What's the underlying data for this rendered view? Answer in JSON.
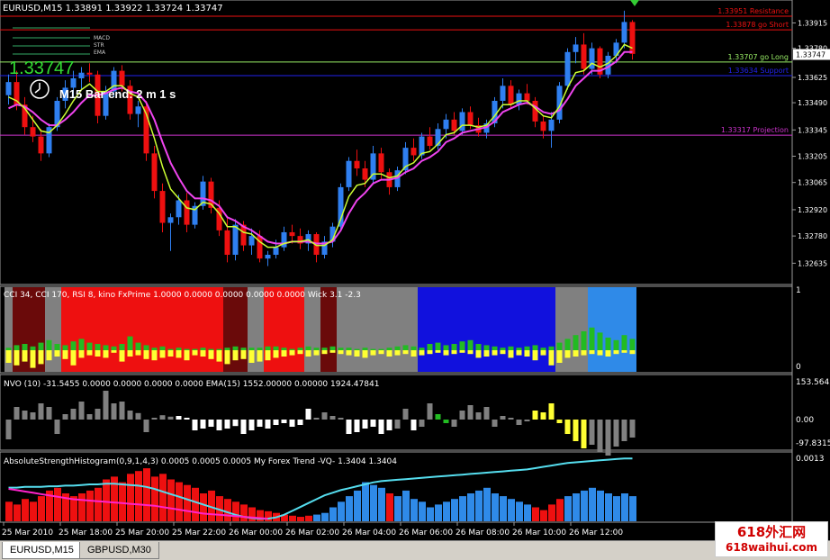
{
  "colors": {
    "bull": "#2f7ff0",
    "bear": "#ee1010",
    "fast_ma": "#ccff33",
    "slow_ma": "#ee44ee",
    "resistance": "#ee1111",
    "support": "#2222ee",
    "projection": "#cc33cc",
    "golong": "#99ee66",
    "grey": "#808080",
    "darkred": "#6a0a0a",
    "red": "#ee1010",
    "blue": "#1111dd",
    "lightblue": "#2f8ae8",
    "green": "#22bb22",
    "yellow": "#ffff33",
    "white": "#ffffff",
    "cyan": "#55ddee",
    "magenta": "#ff22cc"
  },
  "main": {
    "title": "EURUSD,M15  1.33891 1.33922 1.33724 1.33747",
    "price_big": "1.33747",
    "bar_end": "M15 Bar end: 2 m 1 s",
    "legend": [
      "MACD",
      "STR",
      "EMA"
    ],
    "levels": [
      {
        "label": "1.33951 Resistance",
        "value": 1.33951,
        "color": "resistance"
      },
      {
        "label": "1.33878 go Short",
        "value": 1.33878,
        "color": "resistance"
      },
      {
        "label": "1.33707 go Long",
        "value": 1.33707,
        "color": "golong"
      },
      {
        "label": "1.33634 Support",
        "value": 1.33634,
        "color": "support"
      },
      {
        "label": "1.33317 Projection",
        "value": 1.33317,
        "color": "projection"
      }
    ],
    "current_price_label": "1.33747",
    "current_price": 1.33747
  },
  "ind1": {
    "title": "CCI 34, CCI 170, RSI 8,  kino FxPrime  1.0000 0.0000 0.0000 0.0000 0.0000  Wick 3.1 -2.3",
    "scale": [
      "1",
      "0"
    ]
  },
  "ind2": {
    "title": "NVO (10) -31.5455 0.0000 0.0000 0.0000 0.0000  EMA(15) 1552.00000 0.00000 1924.47841",
    "scale": [
      "153.5643",
      "0.00",
      "-97.8315"
    ]
  },
  "ind3": {
    "title": "AbsoluteStrengthHistogram(0,9,1,4,3) 0.0005 0.0005 0.0005  My Forex Trend -VQ- 1.3404 1.3404",
    "scale": [
      "0.0013"
    ]
  },
  "time_labels": [
    "25 Mar 2010",
    "25 Mar 18:00",
    "25 Mar 20:00",
    "25 Mar 22:00",
    "26 Mar 00:00",
    "26 Mar 02:00",
    "26 Mar 04:00",
    "26 Mar 06:00",
    "26 Mar 08:00",
    "26 Mar 10:00",
    "26 Mar 12:00"
  ],
  "tabs": [
    "EURUSD,M15",
    "GBPUSD,M30"
  ],
  "watermark": {
    "line1": "618外汇网",
    "line2": "618waihui.com"
  },
  "chart_data": {
    "type": "candlestick",
    "symbol": "EURUSD",
    "timeframe": "M15",
    "ylim": [
      1.3256,
      1.3397
    ],
    "yticks": [
      1.33915,
      1.3378,
      1.33625,
      1.3349,
      1.33345,
      1.33205,
      1.33065,
      1.3292,
      1.3278,
      1.32635
    ],
    "ohlc": [
      [
        1.3353,
        1.3364,
        1.3348,
        1.336
      ],
      [
        1.336,
        1.3366,
        1.3345,
        1.3348
      ],
      [
        1.3348,
        1.3352,
        1.3332,
        1.3336
      ],
      [
        1.3336,
        1.3342,
        1.3328,
        1.3331
      ],
      [
        1.3331,
        1.3335,
        1.3318,
        1.3322
      ],
      [
        1.3322,
        1.3338,
        1.332,
        1.3336
      ],
      [
        1.3336,
        1.3352,
        1.3334,
        1.335
      ],
      [
        1.335,
        1.3361,
        1.3346,
        1.3357
      ],
      [
        1.3357,
        1.3366,
        1.3352,
        1.3362
      ],
      [
        1.3362,
        1.3368,
        1.3356,
        1.3365
      ],
      [
        1.3365,
        1.337,
        1.336,
        1.3364
      ],
      [
        1.3364,
        1.3366,
        1.3338,
        1.3342
      ],
      [
        1.3342,
        1.3358,
        1.334,
        1.3355
      ],
      [
        1.3355,
        1.3368,
        1.3352,
        1.3366
      ],
      [
        1.3366,
        1.3369,
        1.3355,
        1.3358
      ],
      [
        1.3358,
        1.3361,
        1.334,
        1.3343
      ],
      [
        1.3343,
        1.335,
        1.3336,
        1.3347
      ],
      [
        1.3347,
        1.335,
        1.3318,
        1.3322
      ],
      [
        1.3322,
        1.3326,
        1.3298,
        1.3302
      ],
      [
        1.3302,
        1.3306,
        1.328,
        1.3285
      ],
      [
        1.3285,
        1.329,
        1.327,
        1.3288
      ],
      [
        1.3288,
        1.33,
        1.3284,
        1.3297
      ],
      [
        1.3297,
        1.3301,
        1.328,
        1.3284
      ],
      [
        1.3284,
        1.3296,
        1.3282,
        1.3294
      ],
      [
        1.3294,
        1.331,
        1.3292,
        1.3307
      ],
      [
        1.3307,
        1.3309,
        1.329,
        1.3293
      ],
      [
        1.3293,
        1.3297,
        1.3278,
        1.3281
      ],
      [
        1.3281,
        1.3288,
        1.3264,
        1.3268
      ],
      [
        1.3268,
        1.3287,
        1.3265,
        1.3284
      ],
      [
        1.3284,
        1.3286,
        1.327,
        1.3273
      ],
      [
        1.3273,
        1.3282,
        1.3268,
        1.3278
      ],
      [
        1.3278,
        1.3281,
        1.3264,
        1.3266
      ],
      [
        1.3266,
        1.327,
        1.3262,
        1.3268
      ],
      [
        1.3268,
        1.3276,
        1.3266,
        1.3272
      ],
      [
        1.3272,
        1.3283,
        1.327,
        1.328
      ],
      [
        1.328,
        1.3284,
        1.3274,
        1.3278
      ],
      [
        1.3278,
        1.3282,
        1.3271,
        1.3274
      ],
      [
        1.3274,
        1.3281,
        1.327,
        1.3279
      ],
      [
        1.3279,
        1.328,
        1.3264,
        1.3268
      ],
      [
        1.3268,
        1.3278,
        1.3266,
        1.3275
      ],
      [
        1.3275,
        1.3285,
        1.3272,
        1.3283
      ],
      [
        1.3283,
        1.3306,
        1.3281,
        1.3304
      ],
      [
        1.3304,
        1.332,
        1.3302,
        1.3318
      ],
      [
        1.3318,
        1.3324,
        1.331,
        1.3314
      ],
      [
        1.3314,
        1.3318,
        1.3304,
        1.3308
      ],
      [
        1.3308,
        1.3326,
        1.3306,
        1.3322
      ],
      [
        1.3322,
        1.3325,
        1.3308,
        1.3312
      ],
      [
        1.3312,
        1.3314,
        1.33,
        1.3304
      ],
      [
        1.3304,
        1.3315,
        1.3302,
        1.3313
      ],
      [
        1.3313,
        1.3328,
        1.3311,
        1.3325
      ],
      [
        1.3325,
        1.333,
        1.3318,
        1.3321
      ],
      [
        1.3321,
        1.3333,
        1.3319,
        1.3331
      ],
      [
        1.3331,
        1.3336,
        1.3324,
        1.3326
      ],
      [
        1.3326,
        1.3338,
        1.3324,
        1.3335
      ],
      [
        1.3335,
        1.3343,
        1.333,
        1.334
      ],
      [
        1.334,
        1.3344,
        1.3332,
        1.3334
      ],
      [
        1.3334,
        1.3346,
        1.3332,
        1.3344
      ],
      [
        1.3344,
        1.3347,
        1.3335,
        1.3337
      ],
      [
        1.3337,
        1.3341,
        1.3331,
        1.3333
      ],
      [
        1.3333,
        1.334,
        1.333,
        1.3338
      ],
      [
        1.3338,
        1.3352,
        1.3336,
        1.335
      ],
      [
        1.335,
        1.3362,
        1.3346,
        1.3358
      ],
      [
        1.3358,
        1.3361,
        1.3346,
        1.3348
      ],
      [
        1.3348,
        1.3356,
        1.3345,
        1.3354
      ],
      [
        1.3354,
        1.3359,
        1.3348,
        1.335
      ],
      [
        1.335,
        1.3352,
        1.3336,
        1.3339
      ],
      [
        1.3339,
        1.3342,
        1.333,
        1.3334
      ],
      [
        1.3334,
        1.3344,
        1.3325,
        1.334
      ],
      [
        1.334,
        1.336,
        1.3338,
        1.3358
      ],
      [
        1.3358,
        1.3378,
        1.3356,
        1.3376
      ],
      [
        1.3376,
        1.3384,
        1.337,
        1.338
      ],
      [
        1.338,
        1.3386,
        1.3364,
        1.3367
      ],
      [
        1.3367,
        1.3381,
        1.3364,
        1.3378
      ],
      [
        1.3378,
        1.3379,
        1.3362,
        1.3364
      ],
      [
        1.3364,
        1.3376,
        1.3362,
        1.3374
      ],
      [
        1.3374,
        1.3383,
        1.337,
        1.3381
      ],
      [
        1.3381,
        1.3398,
        1.3378,
        1.3392
      ],
      [
        1.3392,
        1.3393,
        1.3372,
        1.3375
      ]
    ],
    "fast_ma": [
      1.3352,
      1.335,
      1.3346,
      1.334,
      1.3334,
      1.3333,
      1.3337,
      1.3343,
      1.335,
      1.3356,
      1.3359,
      1.3355,
      1.3355,
      1.3358,
      1.3358,
      1.3354,
      1.3352,
      1.3343,
      1.333,
      1.3315,
      1.3303,
      1.3298,
      1.3293,
      1.3292,
      1.3296,
      1.3295,
      1.329,
      1.3283,
      1.3283,
      1.328,
      1.3279,
      1.3275,
      1.3272,
      1.3272,
      1.3274,
      1.3275,
      1.3275,
      1.3276,
      1.3273,
      1.3273,
      1.3276,
      1.3287,
      1.3299,
      1.3305,
      1.3306,
      1.3311,
      1.3311,
      1.3309,
      1.331,
      1.3315,
      1.3317,
      1.3322,
      1.3323,
      1.3327,
      1.3332,
      1.3333,
      1.3337,
      1.3337,
      1.3336,
      1.3337,
      1.3342,
      1.3348,
      1.3348,
      1.335,
      1.335,
      1.3346,
      1.3342,
      1.3341,
      1.3347,
      1.3357,
      1.3365,
      1.3366,
      1.337,
      1.3368,
      1.337,
      1.3374,
      1.338,
      1.3378
    ],
    "slow_ma": [
      1.3346,
      1.3348,
      1.3347,
      1.3344,
      1.334,
      1.3337,
      1.3337,
      1.334,
      1.3344,
      1.3349,
      1.3353,
      1.3353,
      1.3354,
      1.3356,
      1.3357,
      1.3355,
      1.3354,
      1.3349,
      1.334,
      1.3328,
      1.3317,
      1.3309,
      1.3302,
      1.3298,
      1.3298,
      1.3297,
      1.3294,
      1.3288,
      1.3286,
      1.3283,
      1.3281,
      1.3278,
      1.3275,
      1.3274,
      1.3274,
      1.3275,
      1.3275,
      1.3275,
      1.3274,
      1.3274,
      1.3275,
      1.3281,
      1.329,
      1.3297,
      1.3301,
      1.3306,
      1.3308,
      1.3308,
      1.3309,
      1.3312,
      1.3314,
      1.3318,
      1.332,
      1.3323,
      1.3328,
      1.333,
      1.3333,
      1.3334,
      1.3335,
      1.3336,
      1.3339,
      1.3344,
      1.3346,
      1.3348,
      1.3349,
      1.3347,
      1.3344,
      1.3343,
      1.3345,
      1.3351,
      1.3358,
      1.3362,
      1.3366,
      1.3366,
      1.3368,
      1.3371,
      1.3376,
      1.3376
    ],
    "ind1_colors": "gddddggrrrrrrrrrrrrrrrrrrrrdddggrrrrrggddggggggggggbbbbbbbbbbbbbbbbbggggBBBBBBBBBBB",
    "ind1_green": [
      0.02,
      0.04,
      0.05,
      0.03,
      0.06,
      0.08,
      0.05,
      0.04,
      0.07,
      0.09,
      0.06,
      0.05,
      0.04,
      0.03,
      0.05,
      0.11,
      0.06,
      0.04,
      0.02,
      0.03,
      0.01,
      0.02,
      0.01,
      0.01,
      0.02,
      0.01,
      0.01,
      0.02,
      0.03,
      0.02,
      0.02,
      0.02,
      0.03,
      0.03,
      0.02,
      0.01,
      0.02,
      0.03,
      0.02,
      0.02,
      0.03,
      0.02,
      0.02,
      0.01,
      0.02,
      0.01,
      0.01,
      0.02,
      0.03,
      0.04,
      0.03,
      0.02,
      0.05,
      0.06,
      0.04,
      0.05,
      0.07,
      0.08,
      0.05,
      0.04,
      0.03,
      0.02,
      0.03,
      0.02,
      0.03,
      0.04,
      0.02,
      0.03,
      0.06,
      0.09,
      0.12,
      0.15,
      0.18,
      0.14,
      0.1,
      0.08,
      0.12,
      0.09
    ],
    "ind1_yellow": [
      0.1,
      0.12,
      0.09,
      0.14,
      0.11,
      0.08,
      0.05,
      0.07,
      0.12,
      0.06,
      0.04,
      0.05,
      0.06,
      0.02,
      0.09,
      0.05,
      0.04,
      0.07,
      0.08,
      0.06,
      0.05,
      0.06,
      0.08,
      0.04,
      0.05,
      0.07,
      0.09,
      0.11,
      0.08,
      0.07,
      0.1,
      0.09,
      0.08,
      0.06,
      0.05,
      0.04,
      0.03,
      0.05,
      0.04,
      0.03,
      0.02,
      0.03,
      0.04,
      0.05,
      0.06,
      0.04,
      0.03,
      0.05,
      0.04,
      0.03,
      0.05,
      0.04,
      0.03,
      0.02,
      0.04,
      0.03,
      0.02,
      0.03,
      0.06,
      0.05,
      0.04,
      0.03,
      0.06,
      0.04,
      0.05,
      0.08,
      0.04,
      0.12,
      0.1,
      0.06,
      0.05,
      0.04,
      0.03,
      0.04,
      0.05,
      0.03,
      0.02,
      0.03
    ],
    "ind2_values": [
      -0.55,
      0.35,
      0.25,
      0.2,
      0.45,
      0.35,
      -0.4,
      0.15,
      0.3,
      0.5,
      0.15,
      0.3,
      0.8,
      0.45,
      0.5,
      0.25,
      0.18,
      -0.35,
      0.05,
      0.12,
      0.08,
      0.1,
      0.05,
      -0.3,
      -0.25,
      -0.2,
      -0.3,
      -0.25,
      -0.18,
      -0.4,
      -0.3,
      -0.2,
      -0.25,
      -0.15,
      -0.1,
      -0.2,
      -0.15,
      0.3,
      0.05,
      0.2,
      0.1,
      0.05,
      -0.4,
      -0.35,
      -0.25,
      -0.2,
      -0.4,
      -0.3,
      -0.25,
      0.3,
      -0.3,
      -0.2,
      0.45,
      0.15,
      -0.1,
      -0.2,
      0.25,
      0.4,
      0.2,
      0.35,
      -0.2,
      0.1,
      0.05,
      -0.15,
      -0.05,
      0.25,
      0.2,
      0.45,
      -0.1,
      -0.4,
      -0.6,
      -0.8,
      -0.7,
      -0.9,
      -1.0,
      -0.75,
      -0.6,
      -0.5
    ],
    "ind2_colors": "gggggggggggggggggggggwwwwwwwwwwwwwwwwwggggwwwwwwggwggGGggggggggggyyyyyyyggggg",
    "ind3_values": [
      0.35,
      0.3,
      0.4,
      0.35,
      0.45,
      0.55,
      0.6,
      0.5,
      0.45,
      0.5,
      0.55,
      0.6,
      0.75,
      0.8,
      0.7,
      0.85,
      0.9,
      0.95,
      0.8,
      0.85,
      0.75,
      0.7,
      0.65,
      0.6,
      0.5,
      0.55,
      0.45,
      0.4,
      0.35,
      0.3,
      0.25,
      0.2,
      0.18,
      0.15,
      0.12,
      0.1,
      0.08,
      0.1,
      0.12,
      0.15,
      0.25,
      0.35,
      0.45,
      0.55,
      0.7,
      0.65,
      0.6,
      0.5,
      0.45,
      0.55,
      0.4,
      0.35,
      0.25,
      0.3,
      0.35,
      0.4,
      0.45,
      0.5,
      0.55,
      0.6,
      0.5,
      0.45,
      0.4,
      0.35,
      0.3,
      0.25,
      0.2,
      0.3,
      0.4,
      0.45,
      0.5,
      0.55,
      0.6,
      0.55,
      0.5,
      0.45,
      0.5,
      0.45
    ],
    "ind3_colors": "rrrrrrrrrrrrrrrrrrrrrrrrrrrrrrrrrrrrrrbbbbbbbbbrbbbbbbbbbbbbbbbbbrrrrbbbbbbbbbbbb",
    "ind3_cyan": [
      0.52,
      0.52,
      0.53,
      0.53,
      0.53,
      0.54,
      0.54,
      0.55,
      0.55,
      0.56,
      0.57,
      0.57,
      0.58,
      0.58,
      0.57,
      0.56,
      0.55,
      0.53,
      0.5,
      0.46,
      0.42,
      0.38,
      0.34,
      0.3,
      0.26,
      0.22,
      0.18,
      0.14,
      0.1,
      0.07,
      0.05,
      0.04,
      0.04,
      0.06,
      0.1,
      0.16,
      0.22,
      0.28,
      0.34,
      0.4,
      0.44,
      0.48,
      0.51,
      0.54,
      0.57,
      0.6,
      0.62,
      0.63,
      0.64,
      0.65,
      0.66,
      0.67,
      0.68,
      0.69,
      0.7,
      0.71,
      0.72,
      0.73,
      0.74,
      0.75,
      0.76,
      0.77,
      0.78,
      0.79,
      0.8,
      0.82,
      0.84,
      0.86,
      0.88,
      0.9,
      0.91,
      0.92,
      0.93,
      0.94,
      0.95,
      0.96,
      0.97,
      0.97
    ],
    "ind3_magenta": [
      0.5,
      0.48,
      0.46,
      0.44,
      0.42,
      0.4,
      0.38,
      0.36,
      0.34,
      0.33,
      0.32,
      0.31,
      0.3,
      0.29,
      0.28,
      0.27,
      0.26,
      0.25,
      0.24,
      0.22,
      0.2,
      0.18,
      0.16,
      0.14,
      0.12,
      0.11,
      0.1,
      0.09,
      0.08,
      0.07,
      0.06,
      0.05,
      0.04
    ]
  }
}
